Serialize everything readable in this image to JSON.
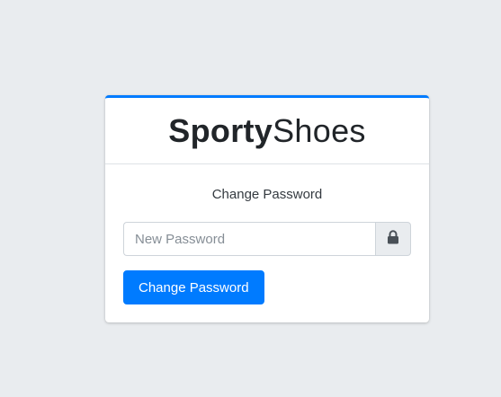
{
  "brand": {
    "bold": "Sporty",
    "light": "Shoes"
  },
  "form": {
    "title": "Change Password",
    "password_placeholder": "New Password",
    "password_icon": "lock-icon",
    "submit_label": "Change Password"
  },
  "colors": {
    "accent": "#007bff",
    "background": "#e9ecef",
    "card": "#ffffff"
  }
}
